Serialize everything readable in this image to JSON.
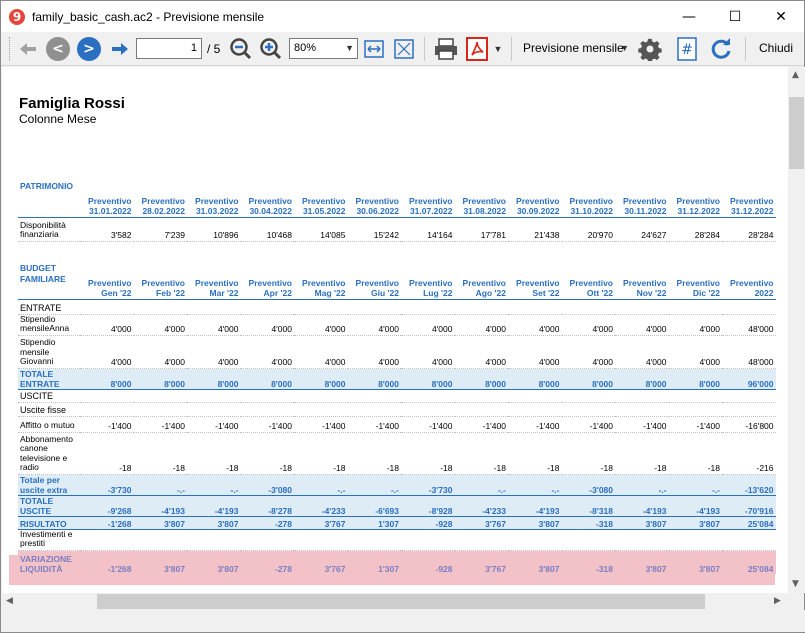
{
  "window": {
    "title": "family_basic_cash.ac2 - Previsione mensile",
    "minimize": "—",
    "maximize": "☐",
    "close": "✕"
  },
  "toolbar": {
    "page_current": "1",
    "page_total": "/ 5",
    "zoom": "80%",
    "view_label": "Previsione mensile",
    "close_label": "Chiudi",
    "icons": [
      "first-page-icon",
      "prev-page-icon",
      "next-page-icon",
      "last-page-icon",
      "zoom-out-icon",
      "zoom-in-icon",
      "fit-width-icon",
      "fit-page-icon",
      "print-icon",
      "pdf-icon",
      "settings-icon",
      "hash-icon",
      "refresh-icon"
    ],
    "colors": {
      "nav_blue": "#2a6fc0",
      "nav_gray": "#909090",
      "pdf_red": "#d9261c"
    }
  },
  "report": {
    "title": "Famiglia Rossi",
    "subtitle": "Colonne Mese",
    "patrimonio": {
      "section": "PATRIMONIO",
      "columns": [
        [
          "Preventivo",
          "31.01.2022"
        ],
        [
          "Preventivo",
          "28.02.2022"
        ],
        [
          "Preventivo",
          "31.03.2022"
        ],
        [
          "Preventivo",
          "30.04.2022"
        ],
        [
          "Preventivo",
          "31.05.2022"
        ],
        [
          "Preventivo",
          "30.06.2022"
        ],
        [
          "Preventivo",
          "31.07.2022"
        ],
        [
          "Preventivo",
          "31.08.2022"
        ],
        [
          "Preventivo",
          "30.09.2022"
        ],
        [
          "Preventivo",
          "31.10.2022"
        ],
        [
          "Preventivo",
          "30.11.2022"
        ],
        [
          "Preventivo",
          "31.12.2022"
        ],
        [
          "Preventivo",
          "31.12.2022"
        ]
      ],
      "rows": [
        {
          "label": "Disponibilità finanziaria",
          "values": [
            "3'582",
            "7'239",
            "10'896",
            "10'468",
            "14'085",
            "15'242",
            "14'164",
            "17'781",
            "21'438",
            "20'970",
            "24'627",
            "28'284",
            "28'284"
          ]
        }
      ]
    },
    "budget": {
      "section": "BUDGET FAMILIARE",
      "columns": [
        [
          "Preventivo",
          "Gen '22"
        ],
        [
          "Preventivo",
          "Feb '22"
        ],
        [
          "Preventivo",
          "Mar '22"
        ],
        [
          "Preventivo",
          "Apr '22"
        ],
        [
          "Preventivo",
          "Mag '22"
        ],
        [
          "Preventivo",
          "Giu '22"
        ],
        [
          "Preventivo",
          "Lug '22"
        ],
        [
          "Preventivo",
          "Ago '22"
        ],
        [
          "Preventivo",
          "Set '22"
        ],
        [
          "Preventivo",
          "Ott '22"
        ],
        [
          "Preventivo",
          "Nov '22"
        ],
        [
          "Preventivo",
          "Dic '22"
        ],
        [
          "Preventivo",
          "2022"
        ]
      ],
      "rows": [
        {
          "type": "sec",
          "label": "ENTRATE",
          "values": []
        },
        {
          "type": "row",
          "label": "Stipendio mensileAnna",
          "values": [
            "4'000",
            "4'000",
            "4'000",
            "4'000",
            "4'000",
            "4'000",
            "4'000",
            "4'000",
            "4'000",
            "4'000",
            "4'000",
            "4'000",
            "48'000"
          ]
        },
        {
          "type": "row",
          "label": "Stipendio mensile Giovanni",
          "values": [
            "4'000",
            "4'000",
            "4'000",
            "4'000",
            "4'000",
            "4'000",
            "4'000",
            "4'000",
            "4'000",
            "4'000",
            "4'000",
            "4'000",
            "48'000"
          ]
        },
        {
          "type": "tot",
          "label": "TOTALE ENTRATE",
          "values": [
            "8'000",
            "8'000",
            "8'000",
            "8'000",
            "8'000",
            "8'000",
            "8'000",
            "8'000",
            "8'000",
            "8'000",
            "8'000",
            "8'000",
            "96'000"
          ]
        },
        {
          "type": "sec",
          "label": "USCITE",
          "values": []
        },
        {
          "type": "sec",
          "label": "Uscite fisse",
          "values": []
        },
        {
          "type": "row",
          "label": "Affitto o mutuo",
          "values": [
            "-1'400",
            "-1'400",
            "-1'400",
            "-1'400",
            "-1'400",
            "-1'400",
            "-1'400",
            "-1'400",
            "-1'400",
            "-1'400",
            "-1'400",
            "-1'400",
            "-16'800"
          ]
        },
        {
          "type": "row",
          "label": "Abbonamento canone televisione e radio",
          "values": [
            "-18",
            "-18",
            "-18",
            "-18",
            "-18",
            "-18",
            "-18",
            "-18",
            "-18",
            "-18",
            "-18",
            "-18",
            "-216"
          ]
        },
        {
          "type": "tot",
          "label": "Totale per uscite extra",
          "values": [
            "-3'730",
            "-.-",
            "-.-",
            "-3'080",
            "-.-",
            "-.-",
            "-3'730",
            "-.-",
            "-.-",
            "-3'080",
            "-.-",
            "-.-",
            "-13'620"
          ]
        },
        {
          "type": "tot",
          "label": "TOTALE USCITE",
          "values": [
            "-9'268",
            "-4'193",
            "-4'193",
            "-8'278",
            "-4'233",
            "-6'693",
            "-8'928",
            "-4'233",
            "-4'193",
            "-8'318",
            "-4'193",
            "-4'193",
            "-70'916"
          ]
        },
        {
          "type": "tot2",
          "label": "RISULTATO",
          "values": [
            "-1'268",
            "3'807",
            "3'807",
            "-278",
            "3'767",
            "1'307",
            "-928",
            "3'767",
            "3'807",
            "-318",
            "3'807",
            "3'807",
            "25'084"
          ]
        },
        {
          "type": "row",
          "label": "Investimenti e prestiti",
          "values": [
            "",
            "",
            "",
            "",
            "",
            "",
            "",
            "",
            "",
            "",
            "",
            "",
            ""
          ]
        },
        {
          "type": "var",
          "label": "VARIAZIONE LIQUIDITÀ",
          "values": [
            "-1'268",
            "3'807",
            "3'807",
            "-278",
            "3'767",
            "1'307",
            "-928",
            "3'767",
            "3'807",
            "-318",
            "3'807",
            "3'807",
            "25'084"
          ]
        }
      ]
    }
  }
}
